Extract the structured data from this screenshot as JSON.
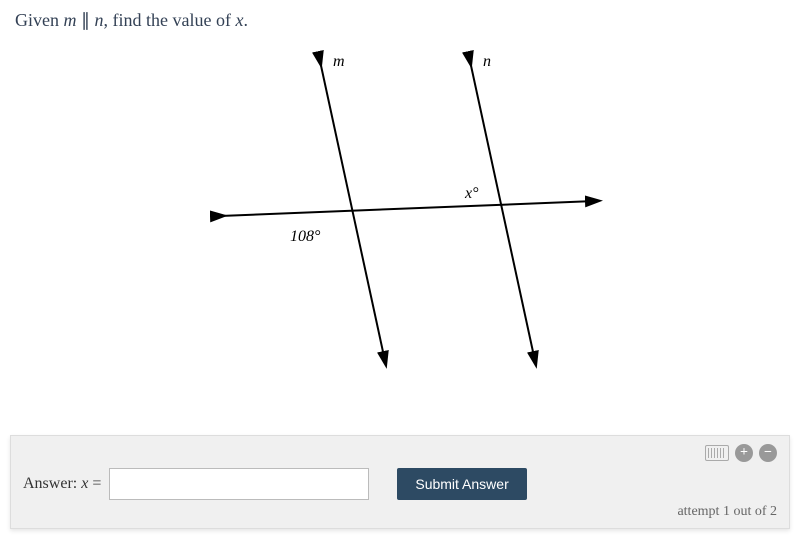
{
  "question": {
    "prefix": "Given ",
    "var_m": "m",
    "parallel": " ∥ ",
    "var_n": "n",
    "suffix": ", find the value of ",
    "var_x": "x",
    "end": "."
  },
  "diagram": {
    "label_m": "m",
    "label_n": "n",
    "angle_known": "108°",
    "angle_unknown": "x°"
  },
  "answer_panel": {
    "label_prefix": "Answer:  ",
    "label_var": "x",
    "label_equals": " = ",
    "submit_label": "Submit Answer",
    "attempt_text": "attempt 1 out of 2",
    "plus": "+",
    "minus": "−"
  },
  "chart_data": {
    "type": "diagram",
    "description": "Two parallel lines m and n cut by a transversal",
    "given_angle": 108,
    "unknown_angle_label": "x"
  }
}
